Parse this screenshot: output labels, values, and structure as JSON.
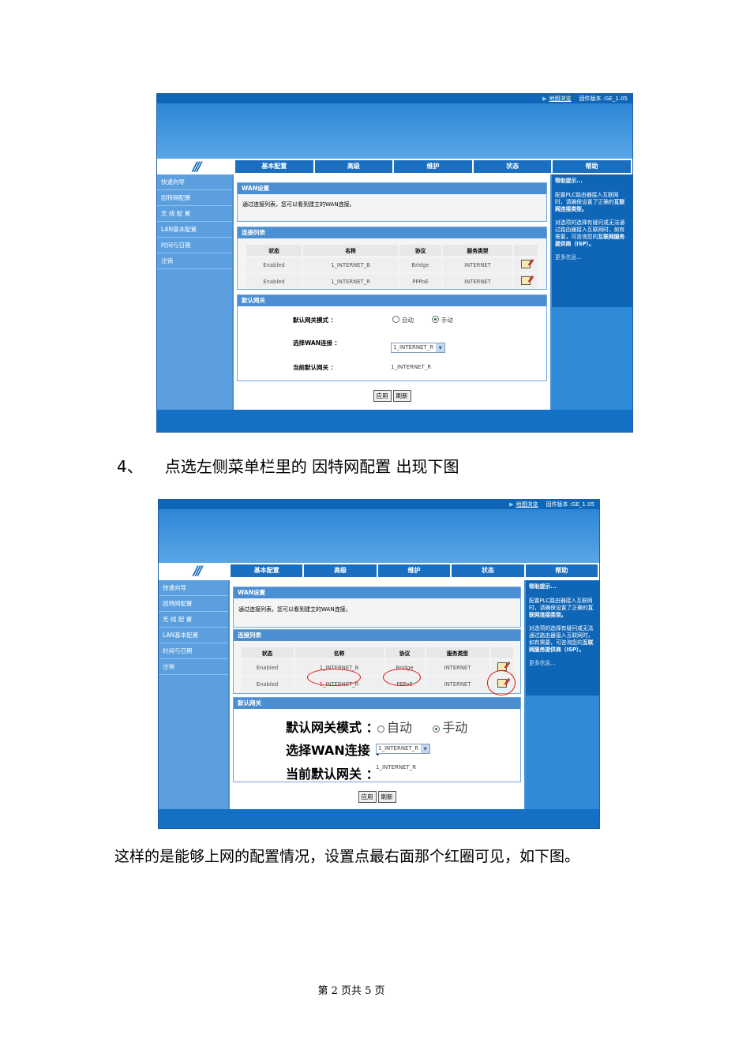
{
  "router": {
    "topbar": {
      "sitemap": "地图浏览",
      "firmware": "固件版本 :GE_1.05"
    },
    "tabs": [
      "基本配置",
      "高级",
      "维护",
      "状态",
      "帮助"
    ],
    "sidebar": [
      "快速向导",
      "因特网配置",
      "无 线 配 置",
      "LAN基本配置",
      "时间与日期",
      "注销"
    ],
    "wan": {
      "title": "WAN设置",
      "desc": "通过连接列表，您可以看到建立的WAN连接。"
    },
    "conn": {
      "title": "连接列表",
      "headers": [
        "状态",
        "名称",
        "协议",
        "服务类型"
      ],
      "rows": [
        [
          "Enabled",
          "1_INTERNET_B",
          "Bridge",
          "INTERNET"
        ],
        [
          "Enabled",
          "1_INTERNET_R",
          "PPPoE",
          "INTERNET"
        ]
      ]
    },
    "gateway": {
      "title": "默认网关",
      "mode_label": "默认网关模式 ：",
      "auto": "自动",
      "manual": "手动",
      "select_label": "选择WAN连接 ：",
      "select_value": "1_INTERNET_R",
      "current_label": "当前默认网关 ：",
      "current_value": "1_INTERNET_R"
    },
    "buttons": {
      "apply": "应用",
      "refresh": "刷新"
    },
    "help": {
      "title": "帮助提示...",
      "p1": "配置PLC路由器接入互联网时，请确保设置了正确的",
      "p1b": "互联网连接类型。",
      "p2": "对选项的选择有疑问或无法通过路由器接入互联网时，如有需要，可咨询您的",
      "p2b": "互联网服务提供商（ISP）。",
      "more": "更多信息..."
    }
  },
  "step": {
    "number": "4、",
    "text": "点选左侧菜单栏里的 因特网配置 出现下图"
  },
  "paragraph": "这样的是能够上网的配置情况，设置点最右面那个红圈可见，如下图。",
  "page_number": "第 2 页共 5 页",
  "colors": {
    "header_blue": "#0f66b6",
    "sidebar_blue": "#5c9fde",
    "annotation_red": "#e01010"
  }
}
